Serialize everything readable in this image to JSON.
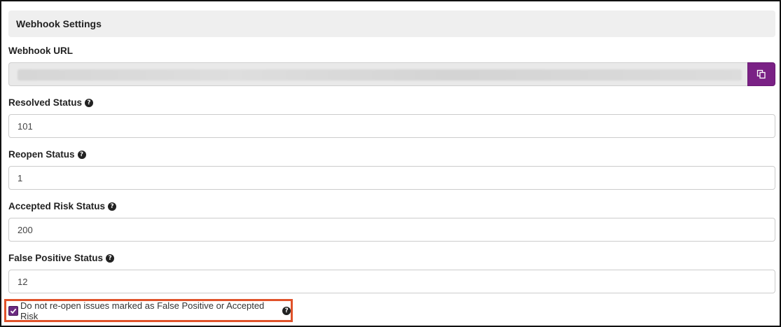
{
  "header": {
    "title": "Webhook Settings"
  },
  "webhook_url": {
    "label": "Webhook URL",
    "value": ""
  },
  "resolved_status": {
    "label": "Resolved Status",
    "value": "101"
  },
  "reopen_status": {
    "label": "Reopen Status",
    "value": "1"
  },
  "accepted_risk_status": {
    "label": "Accepted Risk Status",
    "value": "200"
  },
  "false_positive_status": {
    "label": "False Positive Status",
    "value": "12"
  },
  "no_reopen_checkbox": {
    "label": "Do not re-open issues marked as False Positive or Accepted Risk",
    "checked": true
  },
  "colors": {
    "accent": "#7a2185",
    "highlight": "#e0522a",
    "header_bg": "#efefef"
  },
  "icons": {
    "copy": "copy-icon",
    "help": "question-circle-icon",
    "check": "check-icon"
  }
}
